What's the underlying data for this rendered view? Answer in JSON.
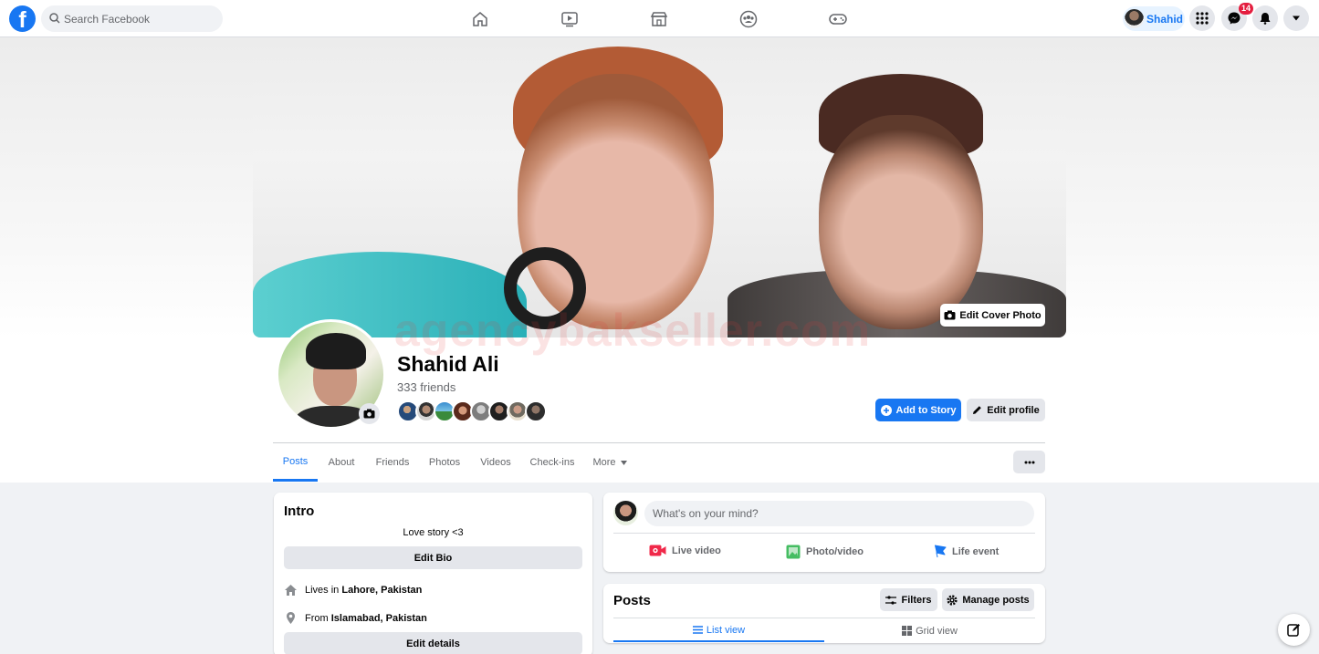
{
  "topbar": {
    "logo_letter": "f",
    "search_placeholder": "Search Facebook",
    "user_name": "Shahid",
    "messenger_badge": "14",
    "nav_icons": [
      "home-icon",
      "watch-icon",
      "marketplace-icon",
      "groups-icon",
      "gaming-icon"
    ]
  },
  "cover": {
    "edit_cover_label": "Edit Cover Photo"
  },
  "watermark": "agencybakseller.com",
  "profile": {
    "name": "Shahid Ali",
    "friends": "333 friends",
    "add_story_label": "Add to Story",
    "edit_profile_label": "Edit profile"
  },
  "tabs": [
    "Posts",
    "About",
    "Friends",
    "Photos",
    "Videos",
    "Check-ins",
    "More"
  ],
  "intro": {
    "title": "Intro",
    "bio": "Love story <3",
    "edit_bio_label": "Edit Bio",
    "lives_prefix": "Lives in",
    "lives_place": "Lahore, Pakistan",
    "from_prefix": "From",
    "from_place": "Islamabad, Pakistan",
    "edit_details_label": "Edit details"
  },
  "composer": {
    "placeholder": "What's on your mind?",
    "actions": [
      "Live video",
      "Photo/video",
      "Life event"
    ]
  },
  "posts": {
    "title": "Posts",
    "filters_label": "Filters",
    "manage_label": "Manage posts",
    "list_view_label": "List view",
    "grid_view_label": "Grid view"
  },
  "colors": {
    "brand": "#1877f2",
    "badge": "#e41e3f",
    "live": "#f02849",
    "photo": "#45bd62",
    "event": "#1877f2"
  }
}
